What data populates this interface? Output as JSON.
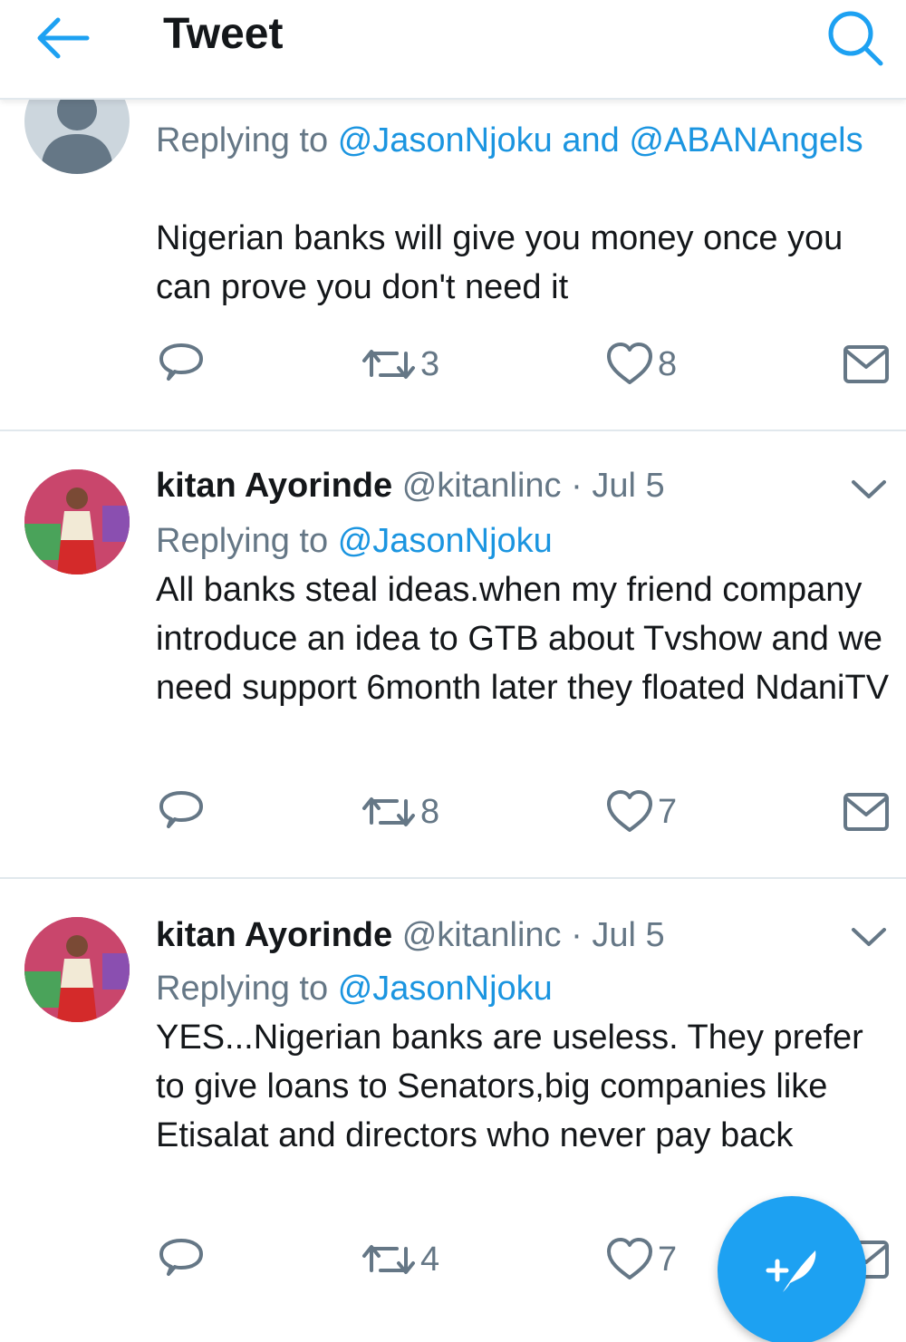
{
  "header": {
    "title": "Tweet",
    "back_icon": "arrow-left-icon",
    "search_icon": "search-icon"
  },
  "colors": {
    "accent": "#1da1f2",
    "link": "#1b95e0",
    "muted": "#657786",
    "divider": "#e1e8ed"
  },
  "tweets": [
    {
      "name": "",
      "handle": "",
      "date": "",
      "replying_label": "Replying to",
      "mentions": "@JasonNjoku and @ABANAngels",
      "text": "Nigerian banks will give you money once you can prove you don't need it",
      "replies": "",
      "retweets": "3",
      "likes": "8"
    },
    {
      "name": "kitan Ayorinde",
      "handle": "@kitanlinc",
      "separator": "·",
      "date": "Jul 5",
      "replying_label": "Replying to",
      "mentions": "@JasonNjoku",
      "text": "All banks steal ideas.when my friend company introduce an idea to GTB about Tvshow and we need support 6month later they floated NdaniTV",
      "replies": "",
      "retweets": "8",
      "likes": "7"
    },
    {
      "name": "kitan Ayorinde",
      "handle": "@kitanlinc",
      "separator": "·",
      "date": "Jul 5",
      "replying_label": "Replying to",
      "mentions": "@JasonNjoku",
      "text": "YES...Nigerian banks are useless. They prefer to give loans to  Senators,big companies like Etisalat and directors who never pay back",
      "replies": "",
      "retweets": "4",
      "likes": "7"
    }
  ],
  "compose_icon": "compose-tweet-icon"
}
